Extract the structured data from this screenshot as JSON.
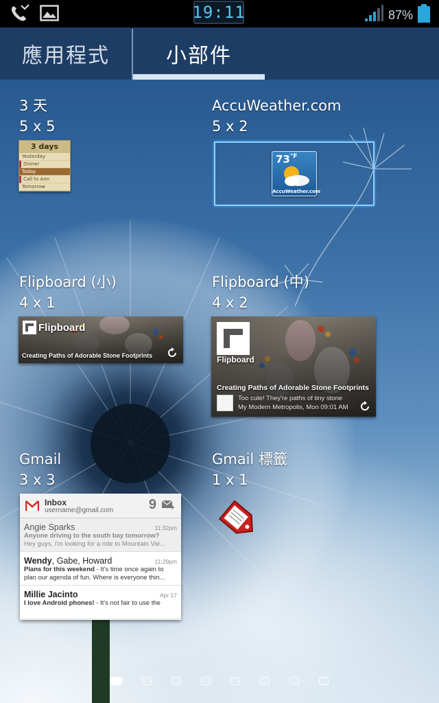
{
  "status_bar": {
    "time": "19:11",
    "battery": "87%",
    "icons": [
      "missed-call-icon",
      "gallery-icon",
      "signal-icon",
      "battery-icon"
    ]
  },
  "tabs": [
    {
      "label": "應用程式",
      "selected": false
    },
    {
      "label": "小部件",
      "selected": true
    }
  ],
  "widgets": [
    {
      "name": "3 天",
      "size": "5 x 5"
    },
    {
      "name": "AccuWeather.com",
      "size": "5 x 2"
    },
    {
      "name": "Flipboard (小)",
      "size": "4 x 1"
    },
    {
      "name": "Flipboard (中)",
      "size": "4 x 2"
    },
    {
      "name": "Gmail",
      "size": "3 x 3"
    },
    {
      "name": "Gmail 標籤",
      "size": "1 x 1"
    }
  ],
  "previews": {
    "three_days": {
      "title": "3 days",
      "rows": [
        "Yesterday",
        "Dinner",
        "Today",
        "Call to Ann",
        "Tomorrow"
      ]
    },
    "accuweather": {
      "temp": "73",
      "unit": "°F",
      "brand": "AccuWeather.com"
    },
    "flipboard_small": {
      "logo": "Flipboard",
      "headline": "Creating Paths of Adorable Stone Footprints"
    },
    "flipboard_medium": {
      "logo": "Flipboard",
      "headline": "Creating Paths of Adorable Stone Footprints",
      "snippet": "Too cute! They're paths of tiny stone",
      "source": "My Modern Metropolis, Mon 09:01 AM"
    },
    "gmail": {
      "folder": "Inbox",
      "account": "username@gmail.com",
      "unread": "9",
      "messages": [
        {
          "from": "Angie Sparks",
          "time": "11:32pm",
          "subject": "Anyone driving to the south bay tomorrow?",
          "snippet": "Hey guys, i'm looking for a ride to Mountain Vie..."
        },
        {
          "from_bold": "Wendy",
          "from_rest": ", Gabe, Howard",
          "time": "11:29pm",
          "subject": "Plans for this weekend",
          "snippet": " - It's time once again to",
          "line3": "plan our agenda of fun. Where is everyone thin..."
        },
        {
          "from": "Millie Jacinto",
          "time": "Apr 17",
          "subject": "I love Android phones!",
          "snippet": " -  It's not fair to use the"
        }
      ]
    }
  },
  "page_indicator": {
    "count": 8,
    "current": 1
  },
  "colors": {
    "tab_bar": "#1e3a60",
    "tab_indicator": "#d8e6f6",
    "clock_text": "#56c7f2",
    "selection_frame": "#8fd0ff"
  }
}
